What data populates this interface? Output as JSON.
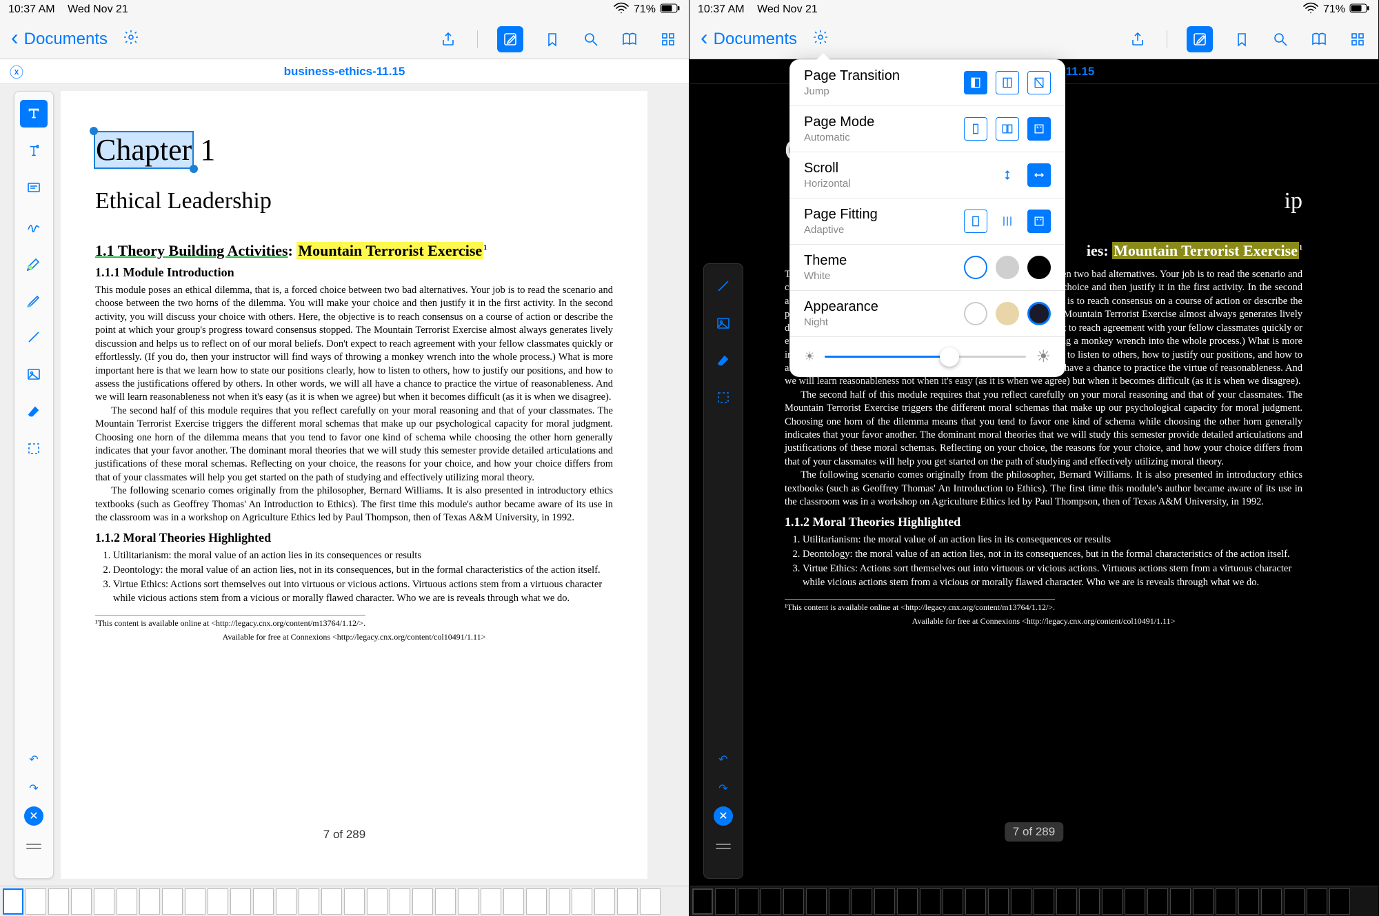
{
  "status": {
    "time": "10:37 AM",
    "date": "Wed Nov 21",
    "battery_pct": "71%"
  },
  "nav": {
    "back_label": "Documents",
    "doc_title": "business-ethics-11.15"
  },
  "settings": {
    "page_transition": {
      "label": "Page Transition",
      "value": "Jump"
    },
    "page_mode": {
      "label": "Page Mode",
      "value": "Automatic"
    },
    "scroll": {
      "label": "Scroll",
      "value": "Horizontal"
    },
    "page_fitting": {
      "label": "Page Fitting",
      "value": "Adaptive"
    },
    "theme": {
      "label": "Theme",
      "value": "White"
    },
    "appearance": {
      "label": "Appearance",
      "value": "Night"
    }
  },
  "doc": {
    "chapter_word": "Chapter",
    "chapter_num": "1",
    "title": "Ethical Leadership",
    "sec_num": "1.1",
    "sec_title": "Theory Building Activities",
    "sec_highlight": "Mountain Terrorist Exercise",
    "sub1_num": "1.1.1",
    "sub1_title": "Module Introduction",
    "para1": "This module poses an ethical dilemma, that is, a forced choice between two bad alternatives. Your job is to read the scenario and choose between the two horns of the dilemma. You will make your choice and then justify it in the first activity. In the second activity, you will discuss your choice with others. Here, the objective is to reach consensus on a course of action or describe the point at which your group's progress toward consensus stopped. The Mountain Terrorist Exercise almost always generates lively discussion and helps us to reflect on of our moral beliefs. Don't expect to reach agreement with your fellow classmates quickly or effortlessly. (If you do, then your instructor will find ways of throwing a monkey wrench into the whole process.) What is more important here is that we learn how to state our positions clearly, how to listen to others, how to justify our positions, and how to assess the justifications offered by others. In other words, we will all have a chance to practice the virtue of reasonableness. And we will learn reasonableness not when it's easy (as it is when we agree) but when it becomes difficult (as it is when we disagree).",
    "para2": "The second half of this module requires that you reflect carefully on your moral reasoning and that of your classmates. The Mountain Terrorist Exercise triggers the different moral schemas that make up our psychological capacity for moral judgment. Choosing one horn of the dilemma means that you tend to favor one kind of schema while choosing the other horn generally indicates that your favor another. The dominant moral theories that we will study this semester provide detailed articulations and justifications of these moral schemas. Reflecting on your choice, the reasons for your choice, and how your choice differs from that of your classmates will help you get started on the path of studying and effectively utilizing moral theory.",
    "para3": "The following scenario comes originally from the philosopher, Bernard Williams. It is also presented in introductory ethics textbooks (such as Geoffrey Thomas' An Introduction to Ethics). The first time this module's author became aware of its use in the classroom was in a workshop on Agriculture Ethics led by Paul Thompson, then of Texas A&M University, in 1992.",
    "sub2_num": "1.1.2",
    "sub2_title": "Moral Theories Highlighted",
    "li1": "Utilitarianism: the moral value of an action lies in its consequences or results",
    "li2": "Deontology: the moral value of an action lies, not in its consequences, but in the formal characteristics of the action itself.",
    "li3": "Virtue Ethics: Actions sort themselves out into virtuous or vicious actions. Virtuous actions stem from a virtuous character while vicious actions stem from a vicious or morally flawed character. Who we are is reveals through what we do.",
    "footnote": "¹This content is available online at <http://legacy.cnx.org/content/m13764/1.12/>.",
    "connexions": "Available for free at Connexions <http://legacy.cnx.org/content/col10491/1.11>",
    "page_of": "7 of 289"
  }
}
